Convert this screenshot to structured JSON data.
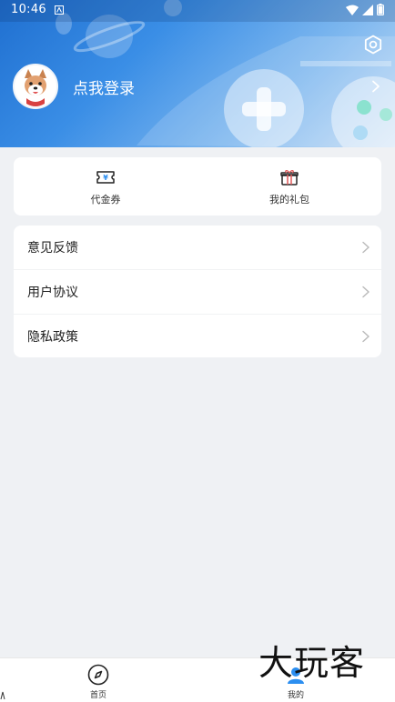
{
  "status_bar": {
    "time": "10:46"
  },
  "header": {
    "login_prompt": "点我登录",
    "settings_icon": "hexagon-settings-icon"
  },
  "quick_actions": [
    {
      "label": "代金券",
      "icon": "voucher-icon",
      "icon_text": "¥"
    },
    {
      "label": "我的礼包",
      "icon": "gift-icon"
    }
  ],
  "menu": {
    "items": [
      {
        "label": "意见反馈"
      },
      {
        "label": "用户协议"
      },
      {
        "label": "隐私政策"
      }
    ]
  },
  "bottom_nav": {
    "items": [
      {
        "label": "首页",
        "icon": "compass-icon"
      },
      {
        "label": "我的",
        "icon": "user-icon",
        "active": true
      }
    ]
  },
  "watermark": "大玩客",
  "colors": {
    "header_gradient_start": "#1f6fd0",
    "header_gradient_end": "#c7def5",
    "background": "#eff1f4",
    "accent": "#2b8ef0"
  }
}
